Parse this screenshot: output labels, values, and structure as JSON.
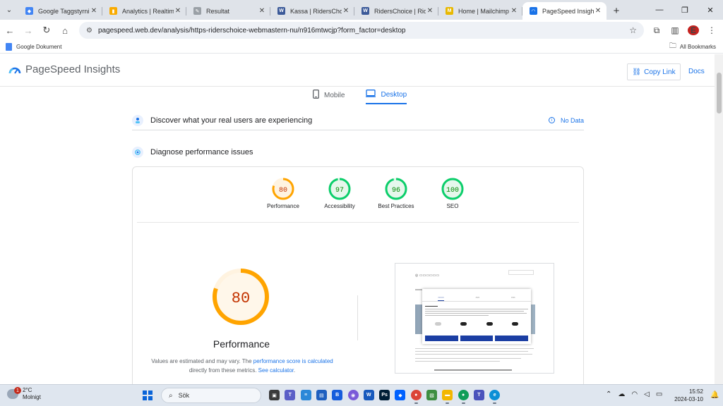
{
  "browser": {
    "tabs": [
      {
        "title": "Google Taggstyrning",
        "icon": "tag-manager-icon",
        "color": "#4285f4",
        "glyph": "◆",
        "active": false
      },
      {
        "title": "Analytics | Realtime o",
        "icon": "analytics-icon",
        "color": "#f9ab00",
        "glyph": "▮",
        "active": false
      },
      {
        "title": "Resultat",
        "icon": "results-icon",
        "color": "#9aa0a6",
        "glyph": "✎",
        "active": false
      },
      {
        "title": "Kassa | RidersChoice",
        "icon": "wordpress-icon",
        "color": "#3c5a99",
        "glyph": "W",
        "active": false
      },
      {
        "title": "RidersChoice | Riders",
        "icon": "wordpress-icon",
        "color": "#3c5a99",
        "glyph": "W",
        "active": false
      },
      {
        "title": "Home | Mailchimp",
        "icon": "mailchimp-icon",
        "color": "#e8b800",
        "glyph": "M",
        "active": false
      },
      {
        "title": "PageSpeed Insights",
        "icon": "pagespeed-icon",
        "color": "#1a73e8",
        "glyph": "◠",
        "active": true
      }
    ],
    "tab_close": "✕",
    "new_tab": "+",
    "window_controls": {
      "minimize": "—",
      "restore": "❐",
      "close": "✕"
    },
    "url": "pagespeed.web.dev/analysis/https-riderschoice-webmastern-nu/n916mtwcjp?form_factor=desktop",
    "profile_initial": "E",
    "bookmarks": {
      "left": "Google Dokument",
      "right": "All Bookmarks"
    }
  },
  "header": {
    "logo_text": "PageSpeed Insights",
    "copy_link": "Copy Link",
    "docs": "Docs"
  },
  "device_tabs": {
    "mobile": "Mobile",
    "desktop": "Desktop"
  },
  "discover": {
    "text": "Discover what your real users are experiencing",
    "status": "No Data"
  },
  "diagnose": {
    "text": "Diagnose performance issues"
  },
  "scores": [
    {
      "label": "Performance",
      "value": 80,
      "color": "#ffa400",
      "track": "#fff3e0",
      "text_color": "#c33300"
    },
    {
      "label": "Accessibility",
      "value": 97,
      "color": "#0cce6b",
      "track": "#e6f7ec",
      "text_color": "#008800"
    },
    {
      "label": "Best Practices",
      "value": 96,
      "color": "#0cce6b",
      "track": "#e6f7ec",
      "text_color": "#008800"
    },
    {
      "label": "SEO",
      "value": 100,
      "color": "#0cce6b",
      "track": "#e6f7ec",
      "text_color": "#008800"
    }
  ],
  "performance_detail": {
    "score": 80,
    "title": "Performance",
    "note_prefix": "Values are estimated and may vary. The ",
    "note_link1": "performance score is calculated",
    "note_middle": " directly from these metrics. ",
    "note_link2": "See calculator",
    "note_suffix": "."
  },
  "taskbar": {
    "temperature": "2°C",
    "condition": "Molnigt",
    "weather_badge": "1",
    "search_label": "Sök",
    "time": "15:52",
    "date": "2024-03-10",
    "apps": [
      {
        "name": "task-view-icon",
        "color": "#3b3b3b",
        "glyph": "▣"
      },
      {
        "name": "teams-icon",
        "color": "#5b5fc7",
        "glyph": "T"
      },
      {
        "name": "notepad-icon",
        "color": "#2b88d8",
        "glyph": "≡"
      },
      {
        "name": "store-icon",
        "color": "#1e5fbf",
        "glyph": "▤"
      },
      {
        "name": "bitwarden-icon",
        "color": "#175ddc",
        "glyph": "B"
      },
      {
        "name": "copilot-icon",
        "color": "#7a5ad8",
        "glyph": "◉"
      },
      {
        "name": "word-icon",
        "color": "#185abd",
        "glyph": "W"
      },
      {
        "name": "photoshop-icon",
        "color": "#001e36",
        "glyph": "Ps"
      },
      {
        "name": "dropbox-icon",
        "color": "#0061ff",
        "glyph": "◆"
      },
      {
        "name": "chrome-icon",
        "color": "#db4437",
        "glyph": "●"
      },
      {
        "name": "photos-icon",
        "color": "#3e8e41",
        "glyph": "▧"
      },
      {
        "name": "explorer-icon",
        "color": "#f3b700",
        "glyph": "▬"
      },
      {
        "name": "chrome-profile-icon",
        "color": "#0f9d58",
        "glyph": "●"
      },
      {
        "name": "teams-work-icon",
        "color": "#4b53bc",
        "glyph": "T"
      },
      {
        "name": "edge-icon",
        "color": "#0c8fd6",
        "glyph": "e"
      }
    ]
  }
}
